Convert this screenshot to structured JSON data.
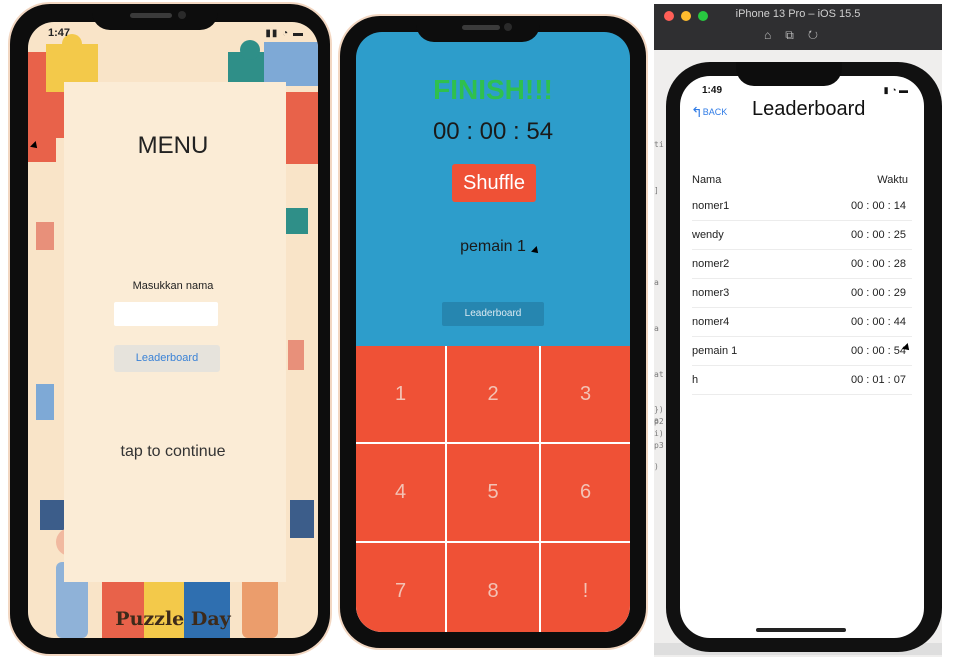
{
  "menu_screen": {
    "time": "1:47",
    "title": "MENU",
    "name_label": "Masukkan nama",
    "name_value": "",
    "leaderboard_button": "Leaderboard",
    "tap_text": "tap to continue",
    "logo_text": "Puzzle Day"
  },
  "game_screen": {
    "finish_text": "FINISH!!!",
    "timer": "00 : 00 : 54",
    "shuffle_button": "Shuffle",
    "player_name": "pemain 1",
    "leaderboard_button": "Leaderboard",
    "tiles": [
      "1",
      "2",
      "3",
      "4",
      "5",
      "6",
      "7",
      "8",
      "!"
    ]
  },
  "simulator": {
    "window_title": "iPhone 13 Pro – iOS 15.5",
    "time": "1:49",
    "back_label": "BACK",
    "title": "Leaderboard",
    "col_name": "Nama",
    "col_time": "Waktu",
    "rows": [
      {
        "name": "nomer1",
        "time": "00 : 00 : 14"
      },
      {
        "name": "wendy",
        "time": "00 : 00 : 25"
      },
      {
        "name": "nomer2",
        "time": "00 : 00 : 28"
      },
      {
        "name": "nomer3",
        "time": "00 : 00 : 29"
      },
      {
        "name": "nomer4",
        "time": "00 : 00 : 44"
      },
      {
        "name": "pemain 1",
        "time": "00 : 00 : 54"
      },
      {
        "name": "h",
        "time": "00 : 01 : 07"
      }
    ]
  },
  "colors": {
    "game_bg": "#2d9dcb",
    "tile": "#ef5136",
    "finish": "#2fc04e",
    "menu_bg": "#f9e4c8",
    "link_blue": "#2f7be6"
  }
}
